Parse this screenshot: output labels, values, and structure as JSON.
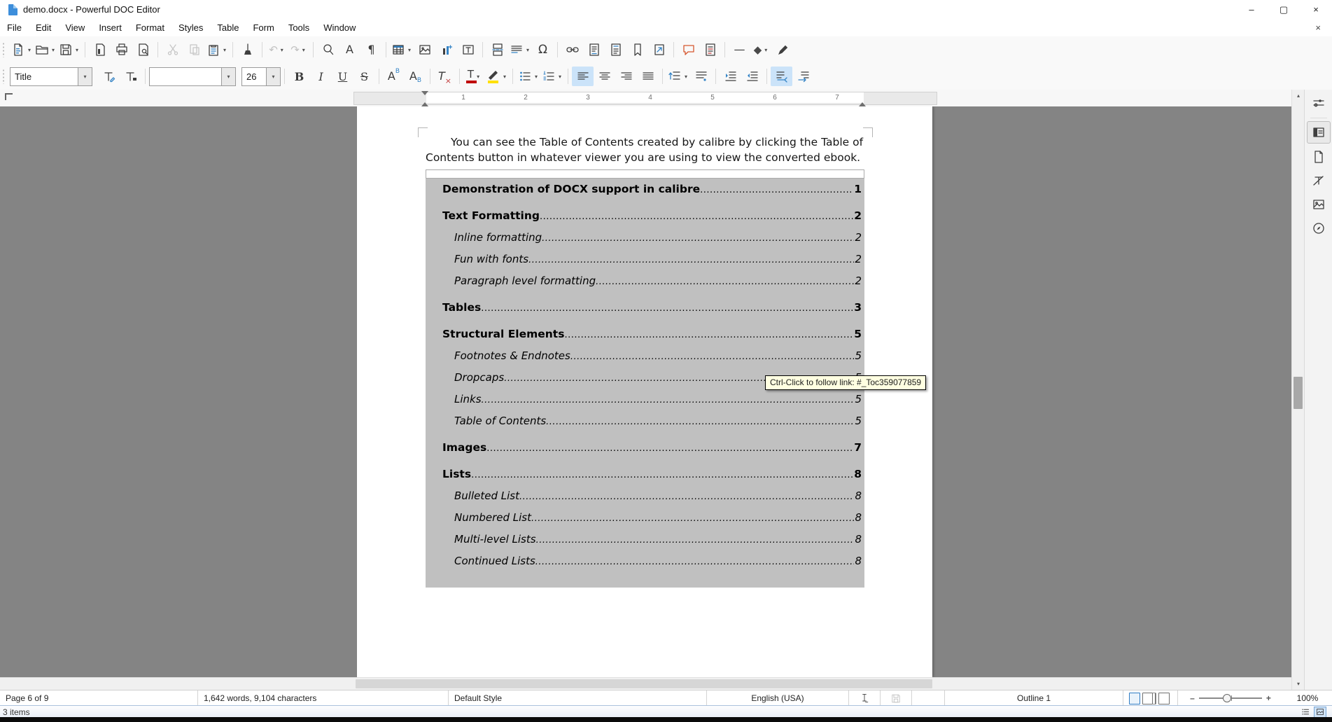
{
  "window": {
    "title": "demo.docx - Powerful DOC Editor",
    "minimize_glyph": "–",
    "maximize_glyph": "▢",
    "close_glyph": "×",
    "doc_close_glyph": "×"
  },
  "menu": {
    "items": [
      "File",
      "Edit",
      "View",
      "Insert",
      "Format",
      "Styles",
      "Table",
      "Form",
      "Tools",
      "Window"
    ]
  },
  "toolbar": {
    "paragraph_style": "Title",
    "font_name": "",
    "font_size": "26",
    "bold": "B",
    "italic": "I",
    "underline": "U",
    "strikethrough": "S",
    "superscript_main": "A",
    "superscript_mark": "B",
    "subscript_main": "A",
    "subscript_mark": "B",
    "clear_main": "T",
    "clear_mark": "×",
    "font_color_main": "T",
    "special_char": "Ω",
    "formatting_marks": "¶",
    "spelling": "A",
    "undo": "↶",
    "redo": "↷",
    "line": "—",
    "shape": "◆",
    "caret": "▾"
  },
  "ruler": {
    "numbers": [
      "1",
      "2",
      "3",
      "4",
      "5",
      "6",
      "7"
    ]
  },
  "document": {
    "paragraph": "You can see the Table of Contents created by calibre by clicking the Table of Contents button in whatever viewer you are using to view the converted ebook.",
    "tooltip": "Ctrl-Click to follow link: #_Toc359077859",
    "toc_entries": [
      {
        "label": "Demonstration of DOCX support in calibre",
        "page": "1",
        "level": 1
      },
      {
        "label": "Text Formatting",
        "page": "2",
        "level": 1
      },
      {
        "label": "Inline formatting",
        "page": "2",
        "level": 2
      },
      {
        "label": "Fun with fonts",
        "page": "2",
        "level": 2
      },
      {
        "label": "Paragraph level formatting",
        "page": "2",
        "level": 2
      },
      {
        "label": "Tables",
        "page": "3",
        "level": 1
      },
      {
        "label": "Structural Elements",
        "page": "5",
        "level": 1
      },
      {
        "label": "Footnotes & Endnotes",
        "page": "5",
        "level": 2
      },
      {
        "label": "Dropcaps",
        "page": "5",
        "level": 2
      },
      {
        "label": "Links",
        "page": "5",
        "level": 2
      },
      {
        "label": "Table of Contents",
        "page": "5",
        "level": 2
      },
      {
        "label": "Images",
        "page": "7",
        "level": 1
      },
      {
        "label": "Lists",
        "page": "8",
        "level": 1
      },
      {
        "label": "Bulleted List",
        "page": "8",
        "level": 2
      },
      {
        "label": "Numbered List",
        "page": "8",
        "level": 2
      },
      {
        "label": "Multi-level Lists",
        "page": "8",
        "level": 2
      },
      {
        "label": "Continued Lists",
        "page": "8",
        "level": 2
      }
    ]
  },
  "status_bar": {
    "page": "Page 6 of 9",
    "word_count": "1,642 words, 9,104 characters",
    "page_style": "Default Style",
    "language": "English (USA)",
    "outline": "Outline 1",
    "zoom_level": "100%",
    "zoom_minus": "–",
    "zoom_plus": "+"
  },
  "taskbar": {
    "items_count": "3 items"
  },
  "colors": {
    "accent_blue": "#3584c6",
    "active_toggle": "#cbe3f9",
    "selection_gray": "#c0c0c0",
    "tooltip_bg": "#ffffe1",
    "comment_orange": "#d6572f",
    "font_color_bar": "#c00000",
    "highlight_bar": "#ffe000"
  }
}
